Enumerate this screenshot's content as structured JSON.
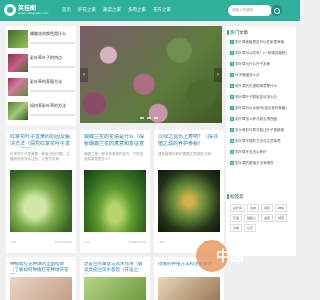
{
  "header": {
    "logo_name": "笑挂图",
    "logo_url": "www.xiaoguatu.com",
    "nav": [
      "首页",
      "护花之家",
      "蔬菜之家",
      "多肉之家",
      "花卉之家"
    ],
    "search_placeholder": "请输入关键词"
  },
  "left_list": [
    {
      "title": "蝴蝶花的颜色是什么"
    },
    {
      "title": "彩叶草叶子的特点"
    },
    {
      "title": "彩叶草的养殖方法"
    },
    {
      "title": "如何养彩叶草的方法"
    }
  ],
  "sidebar": {
    "heading": "热门文章",
    "items": [
      {
        "num": "1",
        "text": "彩叶草种植是否可以在家里养殖"
      },
      {
        "num": "2",
        "text": "彩叶草可以吃吗？(一种观赏植物)"
      },
      {
        "num": "3",
        "text": "彩叶草为什么叶子发黄"
      },
      {
        "num": "4",
        "text": "叶子蜷缩怎么办"
      },
      {
        "num": "5",
        "text": "彩叶草的花语和寓意是什么"
      },
      {
        "num": "6",
        "text": "彩叶草叶子颜色变淡怎么办"
      },
      {
        "num": "7",
        "text": "彩叶草可以水培吗(适合室内种植)"
      },
      {
        "num": "8",
        "text": "彩叶草怎么养才能长得茂盛"
      },
      {
        "num": "9",
        "text": "怎么养彩叶草才能让叶子更鲜艳"
      },
      {
        "num": "10",
        "text": "彩叶草扦插的方法与注意事项"
      },
      {
        "num": "11",
        "text": "彩叶草冬天怎么养护"
      },
      {
        "num": "12",
        "text": "彩叶草的繁殖方法有哪些"
      }
    ],
    "tags_heading": "标签云",
    "tags": [
      "彩叶草",
      "多肉",
      "养殖",
      "种植",
      "花语",
      "蝴蝶兰",
      "盆栽",
      "绿萝",
      "月季",
      "兰花"
    ]
  },
  "cards": [
    {
      "title": "红掌花叶子发黄的原因及解决方法（探究红掌花叶子发黄的原因）",
      "desc": "红掌花叶子发黄是一种常见的问题，主要原因有浇水过多、光照不足等。",
      "meta_left": "196",
      "meta_right": "2020-06-06"
    },
    {
      "title": "蝴蝶兰花的花语是什么（探秘蝴蝶兰花的寓意和象征意义）",
      "desc": "蝴蝶兰是一种非常美丽的花卉，它的花语和寓意是什么？",
      "meta_left": "172",
      "meta_right": "2020-06-06"
    },
    {
      "title": "以绿之源为上寿吧？（探寻植之源的养护奥秘）",
      "desc": "绿色植物的养护需要注意哪些方面？",
      "meta_left": "188",
      "meta_right": "2020-06-06"
    }
  ],
  "bottom": [
    {
      "title": "种植蜡红花种球的全面指南（了解如何种植红花种球开花吧）"
    },
    {
      "title": "虎皮兰的寓意与风水作用（解读虎皮兰风水意思（开运之福））"
    },
    {
      "title": "绿萝的养殖方法和注意事项"
    }
  ],
  "float_badge": "中国"
}
